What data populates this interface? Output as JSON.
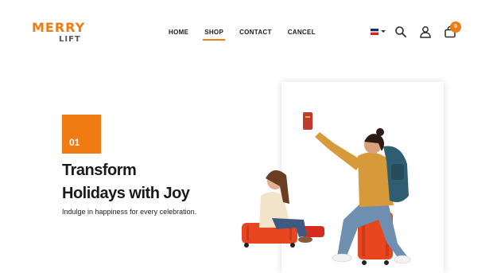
{
  "brand": {
    "logo_top": "MERRY",
    "logo_bottom": "LIFT",
    "accent": "#f07b12"
  },
  "nav": [
    {
      "label": "HOME",
      "active": false
    },
    {
      "label": "SHOP",
      "active": true
    },
    {
      "label": "CONTACT",
      "active": false
    },
    {
      "label": "CANCEL",
      "active": false
    }
  ],
  "header_icons": {
    "flag": "flag-icon",
    "search": "search-icon",
    "user": "user-icon",
    "cart": "cart-icon",
    "cart_count": "0"
  },
  "hero": {
    "number": "01",
    "title_line1": "Transform",
    "title_line2": "Holidays with Joy",
    "subtitle": "Indulge in happiness for every celebration."
  }
}
